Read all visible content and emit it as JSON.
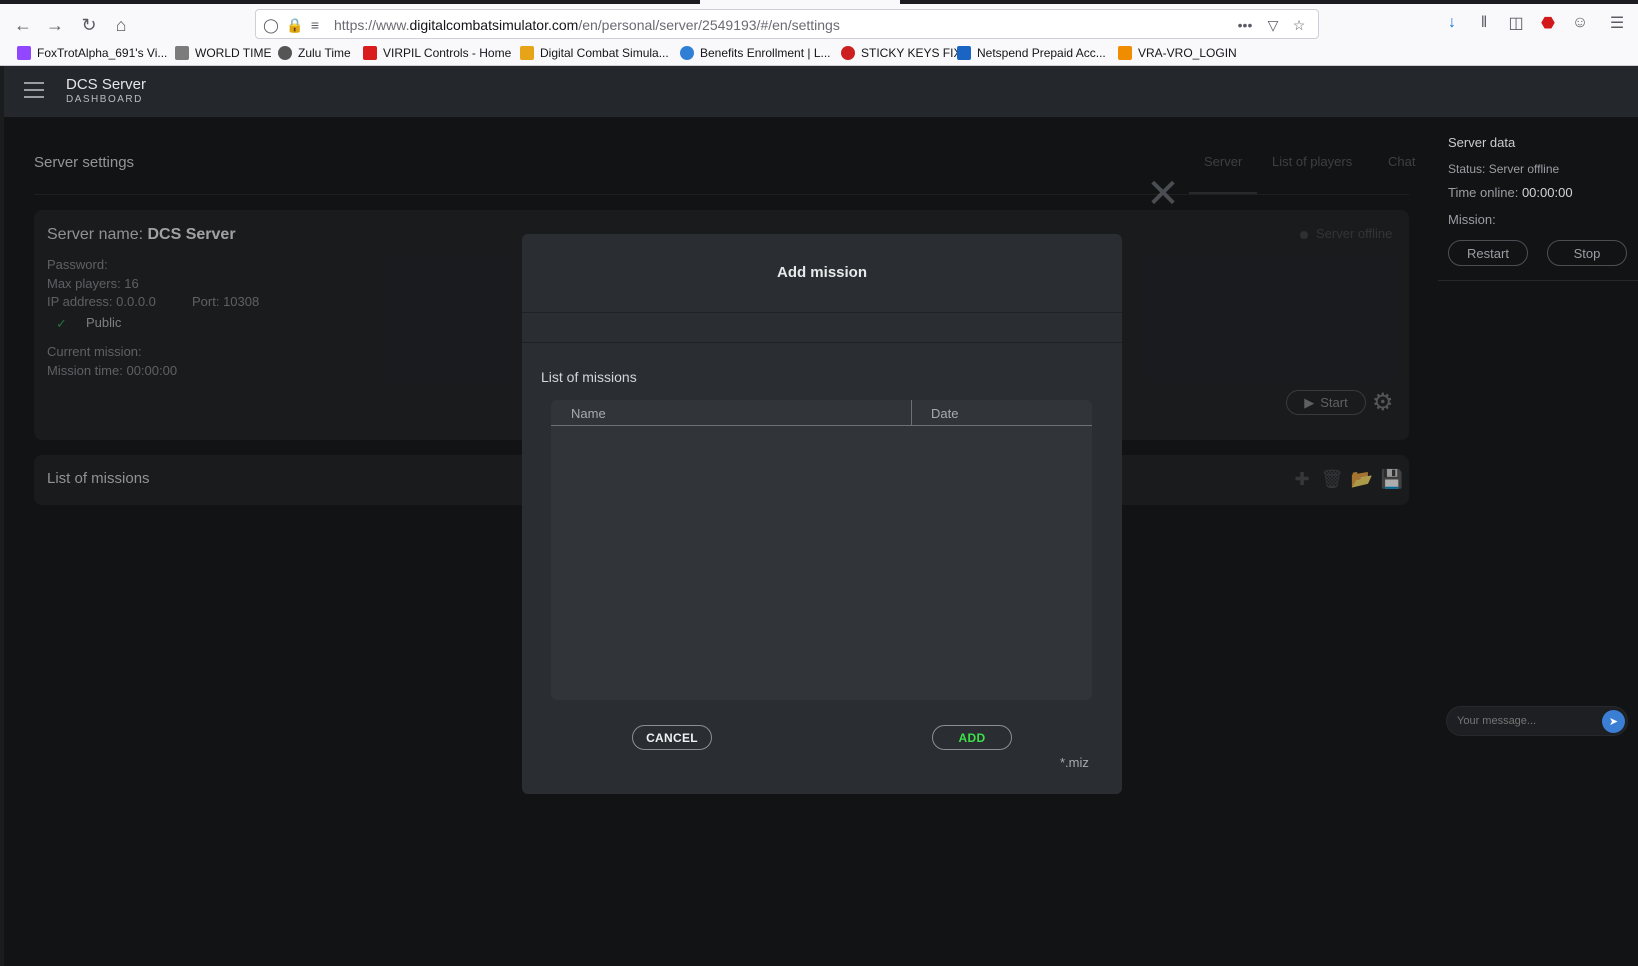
{
  "browser": {
    "url_prefix": "https://www.",
    "url_host": "digitalcombatsimulator.com",
    "url_path": "/en/personal/server/2549193/#/en/settings",
    "more_label": "•••",
    "bookmarks": [
      {
        "label": "FoxTrotAlpha_691's Vi...",
        "color": "#9146ff"
      },
      {
        "label": "WORLD TIME",
        "color": "#7c7c7c"
      },
      {
        "label": "Zulu Time",
        "color": "#555555"
      },
      {
        "label": "VIRPIL Controls - Home",
        "color": "#d91c1c"
      },
      {
        "label": "Digital Combat Simula...",
        "color": "#e8a419"
      },
      {
        "label": "Benefits Enrollment | L...",
        "color": "#2f7fd6"
      },
      {
        "label": "STICKY KEYS FIX",
        "color": "#cc1f1f"
      },
      {
        "label": "Netspend Prepaid Acc...",
        "color": "#1a64c4"
      },
      {
        "label": "VRA-VRO_LOGIN",
        "color": "#f08c00"
      }
    ]
  },
  "app": {
    "title": "DCS Server",
    "subtitle": "DASHBOARD"
  },
  "page": {
    "title": "Server settings",
    "tabs": [
      "Server",
      "List of players",
      "Chat"
    ]
  },
  "server": {
    "name_label": "Server name:",
    "name_value": "DCS Server",
    "password": "Password:",
    "max_players": "Max players: 16",
    "ip": "IP address: 0.0.0.0",
    "port": "Port: 10308",
    "public_label": "Public",
    "current_mission": "Current mission:",
    "mission_time": "Mission time: 00:00:00",
    "status": "Server offline",
    "start_label": "Start"
  },
  "missions": {
    "title": "List of missions"
  },
  "sidebar": {
    "title": "Server data",
    "status": "Status: Server offline",
    "time_label": "Time online:",
    "time_value": "00:00:00",
    "mission": "Mission:",
    "restart": "Restart",
    "stop": "Stop",
    "message_placeholder": "Your message..."
  },
  "modal": {
    "title": "Add mission",
    "list_title": "List of missions",
    "col_name": "Name",
    "col_date": "Date",
    "cancel": "CANCEL",
    "add": "ADD",
    "ext": "*.miz"
  },
  "colors": {
    "accent_green": "#3ee04a",
    "send_blue": "#3a7fd4"
  }
}
